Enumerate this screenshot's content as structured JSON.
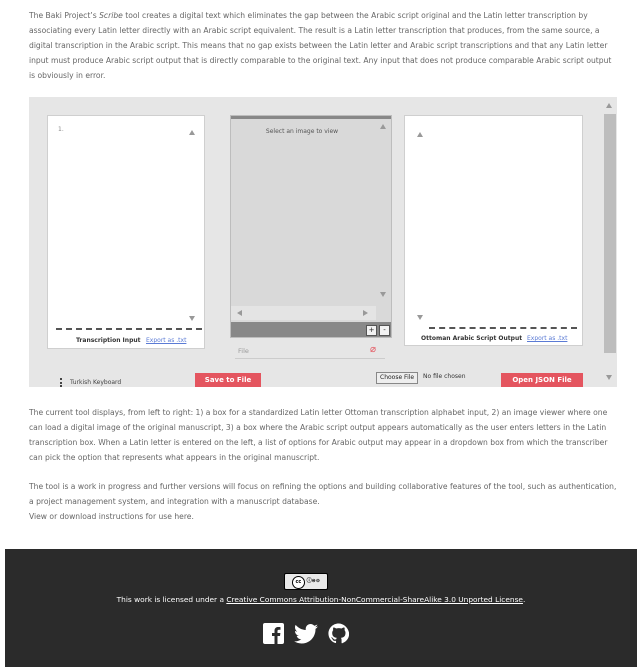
{
  "intro": {
    "part1": "The Baki Project’s ",
    "tool_name": "Scribe",
    "part2": " tool creates a digital text which eliminates the gap between the Arabic script original and the Latin letter transcription by associating every Latin letter directly with an Arabic script equivalent.  The result is a Latin letter transcription that produces, from the same source, a digital transcription in the Arabic script.  This means that no gap exists between the Latin letter and Arabic script transcriptions and that any Latin letter input must produce Arabic script output that is directly comparable to the original text.  Any input that does not produce comparable Arabic script output is obviously in error."
  },
  "tool": {
    "transcription_line_number": "1.",
    "image_viewer_placeholder": "Select an image to view",
    "transcription_label": "Transcription Input",
    "export_txt_label": "Export as .txt",
    "ottoman_label": "Ottoman Arabic Script Output",
    "ottoman_export_label": "Export as .txt",
    "file_placeholder": "File",
    "zoom_in_label": "+",
    "zoom_out_label": "-",
    "save_file_label": "Save to File",
    "choose_file_label": "Choose File",
    "no_file_label": "No file chosen",
    "open_json_label": "Open JSON File",
    "keyboard_label": "Turkish Keyboard"
  },
  "description": "The current tool displays, from left to right: 1) a box for a standardized Latin letter Ottoman transcription alphabet input, 2) an image viewer where one can load a digital image of the original manuscript, 3) a box where the Arabic script output appears automatically as the user enters letters in the Latin transcription box.  When a Latin letter is entered on the left, a list of options for Arabic output may appear in a dropdown box from which the transcriber can pick the option that represents what appears in the original manuscript.",
  "future": {
    "text": "The tool is a work in progress and further versions will focus on refining the options and building collaborative features of the tool, such as authentication, a project management system, and integration with a manuscript database.",
    "instructions_link": "View or download instructions for use here."
  },
  "footer": {
    "license_badge": "cc by nc sa",
    "license_prefix": "This work is licensed under a ",
    "license_link": "Creative Commons Attribution-NonCommercial-ShareAlike 3.0 Unported License",
    "license_suffix": ".",
    "social_icons": [
      "facebook-icon",
      "twitter-icon",
      "github-icon"
    ]
  }
}
